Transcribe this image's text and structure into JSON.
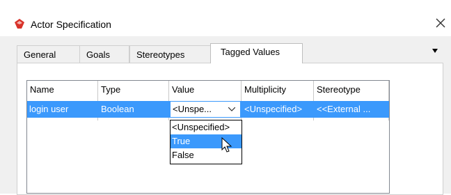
{
  "window": {
    "title": "Actor Specification",
    "app_icon": "actor-spec-icon",
    "close_icon": "close-icon"
  },
  "tabs": [
    {
      "label": "General",
      "active": false
    },
    {
      "label": "Goals",
      "active": false
    },
    {
      "label": "Stereotypes",
      "active": false
    },
    {
      "label": "Tagged Values",
      "active": true
    }
  ],
  "tabs_overflow_icon": "caret-down-icon",
  "table": {
    "columns": [
      "Name",
      "Type",
      "Value",
      "Multiplicity",
      "Stereotype"
    ],
    "rows": [
      {
        "name": "login user",
        "type": "Boolean",
        "value": "<Unspe...",
        "multiplicity": "<Unspecified>",
        "stereotype": "<<External ..."
      }
    ]
  },
  "value_dropdown": {
    "options": [
      "<Unspecified>",
      "True",
      "False"
    ],
    "highlighted": "True"
  },
  "colors": {
    "selection": "#3b99fc",
    "app_icon_red": "#d8322a"
  }
}
